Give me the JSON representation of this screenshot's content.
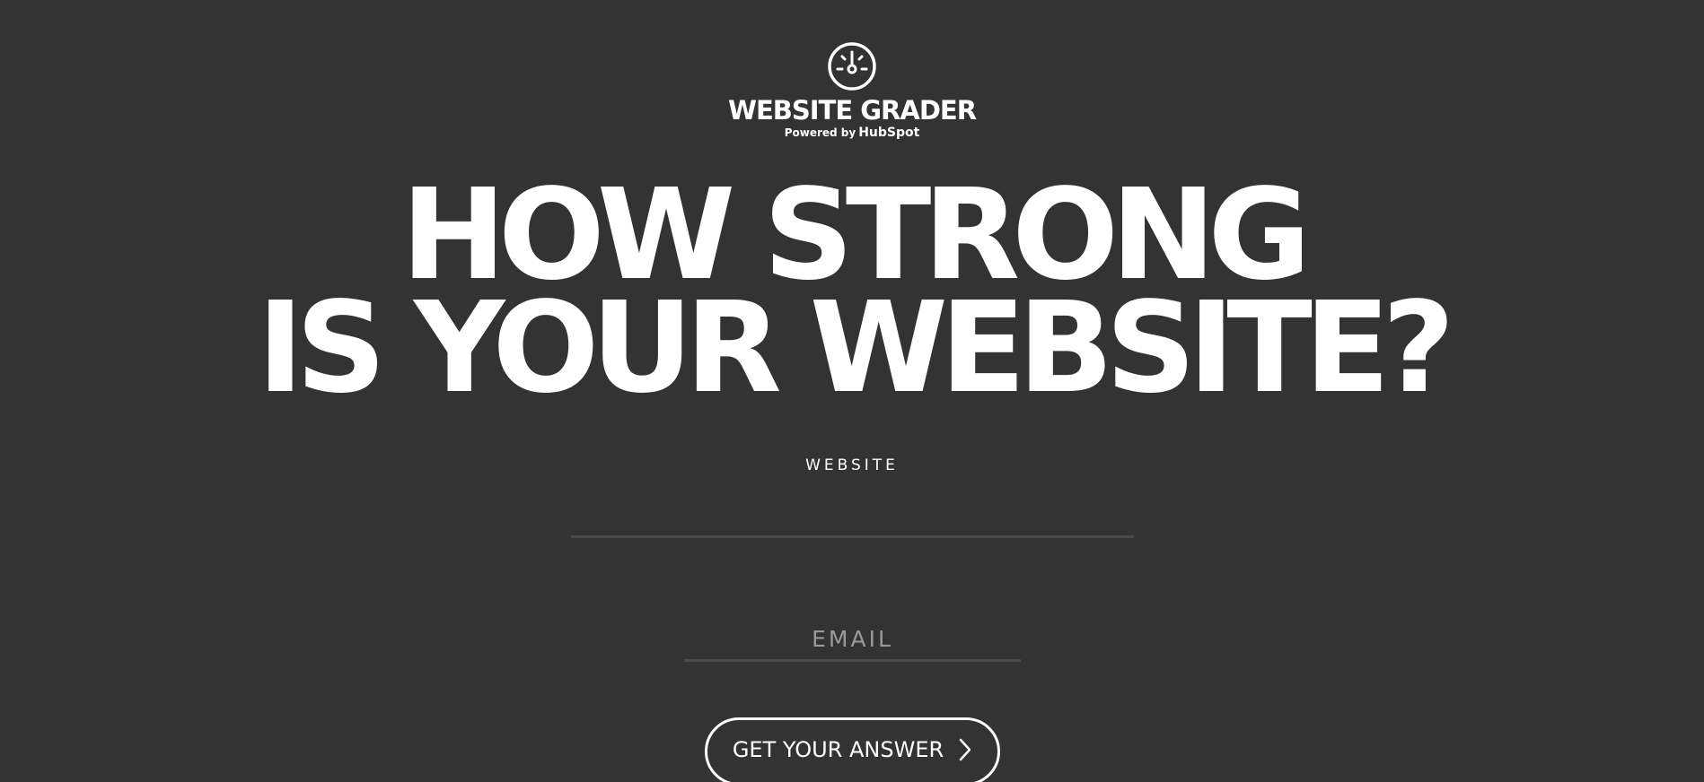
{
  "logo": {
    "icon": "speedometer-icon",
    "title": "WEBSITE GRADER",
    "powered_by": "Powered by",
    "brand": "HubSpot"
  },
  "headline": {
    "line1": "HOW STRONG",
    "line2": "IS YOUR WEBSITE?"
  },
  "form": {
    "website_label": "WEBSITE",
    "website_value": "",
    "email_placeholder": "EMAIL",
    "email_value": "",
    "submit_label": "GET YOUR ANSWER",
    "submit_icon": "chevron-right-icon"
  },
  "colors": {
    "background": "#333333",
    "text": "#ffffff",
    "underline": "#4a4a4a",
    "placeholder": "#9a9a9a"
  }
}
